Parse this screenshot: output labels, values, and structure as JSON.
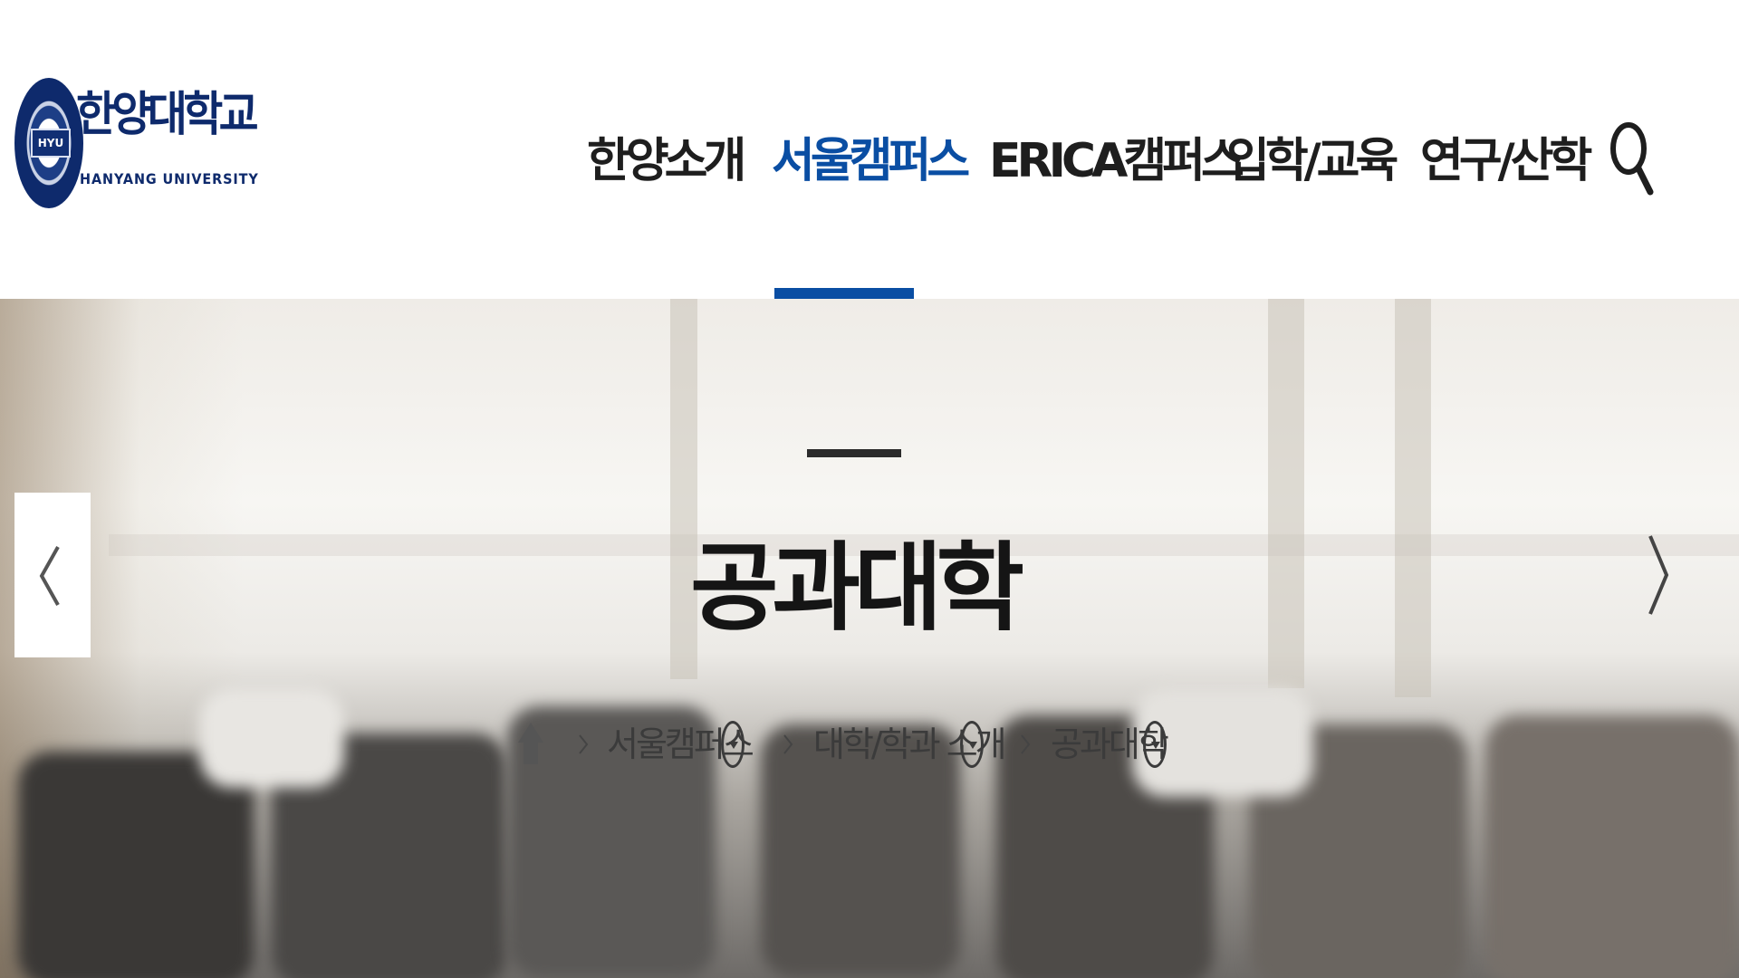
{
  "logo": {
    "name_kr": "한양대학교",
    "name_en": "HANYANG UNIVERSITY",
    "seal_text": "HYU"
  },
  "nav": {
    "items": [
      {
        "label": "한양소개"
      },
      {
        "label": "서울캠퍼스",
        "active": true
      },
      {
        "label": "ERICA캠퍼스"
      },
      {
        "label": "입학/교육"
      },
      {
        "label": "연구/산학"
      }
    ],
    "search_icon": "search-icon",
    "accent_color": "#0a4ea3"
  },
  "hero": {
    "title": "공과대학",
    "prev_icon": "chevron-left-icon",
    "next_icon": "chevron-right-icon"
  },
  "breadcrumb": {
    "home_icon": "home-icon",
    "items": [
      {
        "label": "서울캠퍼스"
      },
      {
        "label": "대학/학과 소개"
      },
      {
        "label": "공과대학"
      }
    ]
  }
}
